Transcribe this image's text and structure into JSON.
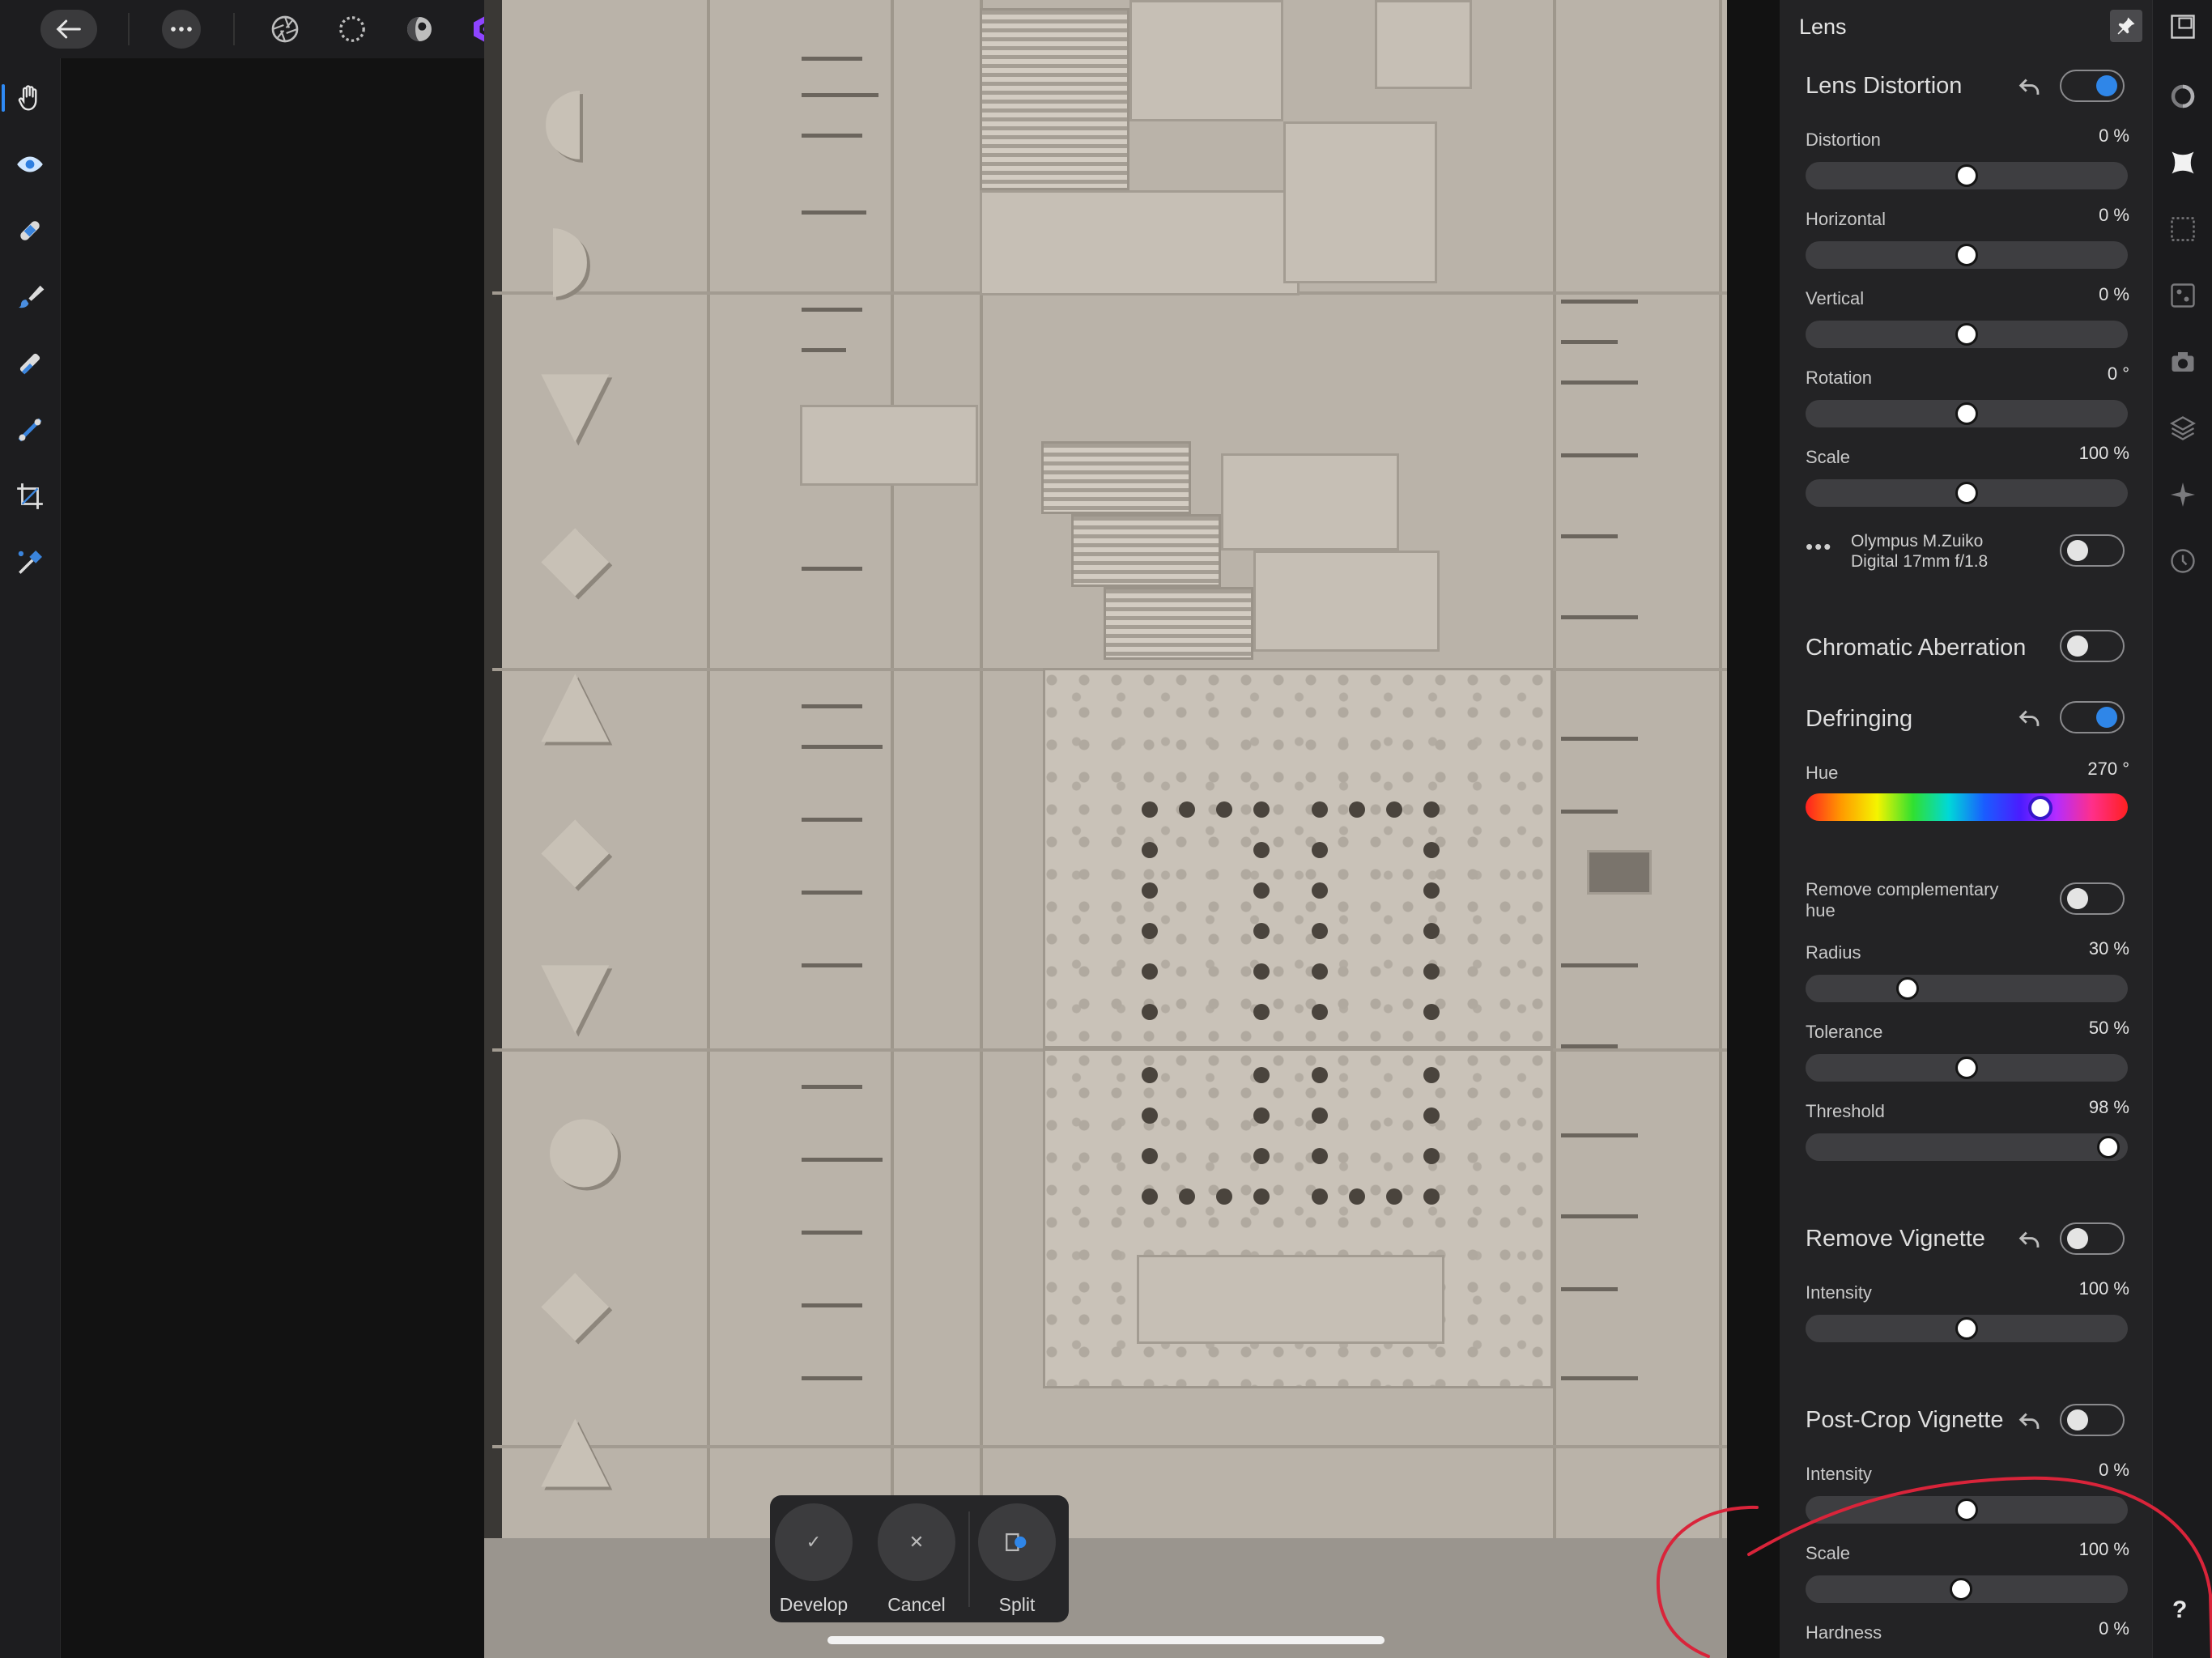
{
  "app": {
    "accent": "#2f86e8",
    "persona_accent": "#8e44ff"
  },
  "top_bar": {
    "icons": [
      "back-arrow-icon",
      "more-icon",
      "photo-persona-icon",
      "liquify-persona-icon",
      "develop-persona-icon",
      "tone-mapping-persona-icon",
      "export-persona-icon"
    ]
  },
  "left_tools": [
    "view-tool",
    "red-eye-tool",
    "blemish-tool",
    "brush-tool",
    "overlay-paint-tool",
    "overlay-gradient-tool",
    "crop-tool",
    "white-balance-picker-tool"
  ],
  "bottom_controls": {
    "develop_label": "Develop",
    "cancel_label": "Cancel",
    "split_label": "Split",
    "develop_glyph": "✓",
    "cancel_glyph": "✕"
  },
  "panel": {
    "title": "Lens",
    "lens_distortion": {
      "title": "Lens Distortion",
      "enabled": true,
      "params": [
        {
          "label": "Distortion",
          "value": "0 %",
          "pos": 0.5
        },
        {
          "label": "Horizontal",
          "value": "0 %",
          "pos": 0.5
        },
        {
          "label": "Vertical",
          "value": "0 %",
          "pos": 0.5
        },
        {
          "label": "Rotation",
          "value": "0 °",
          "pos": 0.5
        },
        {
          "label": "Scale",
          "value": "100 %",
          "pos": 0.5
        }
      ],
      "lens_more": "•••",
      "lens_name_line1": "Olympus M.Zuiko",
      "lens_name_line2": "Digital 17mm f/1.8",
      "lens_profile_enabled": false
    },
    "chromatic_aberration": {
      "title": "Chromatic Aberration",
      "enabled": false
    },
    "defringing": {
      "title": "Defringing",
      "enabled": true,
      "hue": {
        "label": "Hue",
        "value": "270 °",
        "pos": 0.75
      },
      "remove_comp_line1": "Remove complementary",
      "remove_comp_line2": "hue",
      "remove_comp_enabled": false,
      "params": [
        {
          "label": "Radius",
          "value": "30 %",
          "pos": 0.3
        },
        {
          "label": "Tolerance",
          "value": "50 %",
          "pos": 0.5
        },
        {
          "label": "Threshold",
          "value": "98 %",
          "pos": 0.98
        }
      ]
    },
    "remove_vignette": {
      "title": "Remove Vignette",
      "enabled": false,
      "params": [
        {
          "label": "Intensity",
          "value": "100 %",
          "pos": 0.5
        }
      ]
    },
    "post_crop_vignette": {
      "title": "Post-Crop Vignette",
      "enabled": false,
      "params": [
        {
          "label": "Intensity",
          "value": "0 %",
          "pos": 0.5
        },
        {
          "label": "Scale",
          "value": "100 %",
          "pos": 0.48
        },
        {
          "label": "Hardness",
          "value": "0 %",
          "pos": 0.0
        }
      ]
    }
  },
  "studio_rail": {
    "icons": [
      "navigator-icon",
      "basic-icon",
      "lens-icon",
      "details-icon",
      "effects-icon",
      "camera-icon",
      "layers-icon",
      "overlays-icon",
      "history-icon"
    ],
    "help_label": "?"
  }
}
